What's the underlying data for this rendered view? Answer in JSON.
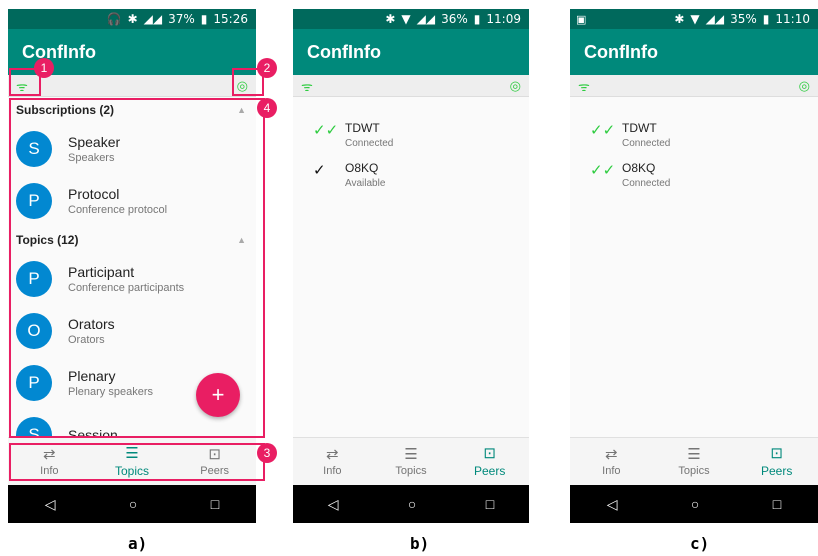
{
  "app_title": "ConfInfo",
  "wifi_icon": "wifi-icon",
  "beacon_icon": "broadcast-icon",
  "nav": {
    "info": "Info",
    "topics": "Topics",
    "peers": "Peers"
  },
  "sysnav": {
    "back": "◁",
    "home": "○",
    "recents": "□"
  },
  "phone_a": {
    "status": {
      "battery": "37%",
      "time": "15:26"
    },
    "subscriptions_header": "Subscriptions (2)",
    "subscriptions": [
      {
        "letter": "S",
        "title": "Speaker",
        "subtitle": "Speakers"
      },
      {
        "letter": "P",
        "title": "Protocol",
        "subtitle": "Conference protocol"
      }
    ],
    "topics_header": "Topics (12)",
    "topics": [
      {
        "letter": "P",
        "title": "Participant",
        "subtitle": "Conference participants"
      },
      {
        "letter": "O",
        "title": "Orators",
        "subtitle": "Orators"
      },
      {
        "letter": "P",
        "title": "Plenary",
        "subtitle": "Plenary speakers"
      },
      {
        "letter": "S",
        "title": "Session",
        "subtitle": ""
      }
    ],
    "fab": "+"
  },
  "phone_b": {
    "status": {
      "battery": "36%",
      "time": "11:09"
    },
    "peers": [
      {
        "name": "TDWT",
        "status": "Connected",
        "check": "double"
      },
      {
        "name": "O8KQ",
        "status": "Available",
        "check": "single"
      }
    ]
  },
  "phone_c": {
    "status": {
      "battery": "35%",
      "time": "11:10"
    },
    "peers": [
      {
        "name": "TDWT",
        "status": "Connected",
        "check": "double"
      },
      {
        "name": "O8KQ",
        "status": "Connected",
        "check": "double"
      }
    ]
  },
  "badges": [
    "1",
    "2",
    "3",
    "4"
  ],
  "captions": [
    "a)",
    "b)",
    "c)"
  ],
  "colors": {
    "primary": "#00897b",
    "primary_dark": "#00695c",
    "accent": "#e91e63",
    "avatar": "#0288d1",
    "signal": "#2ecc40"
  }
}
